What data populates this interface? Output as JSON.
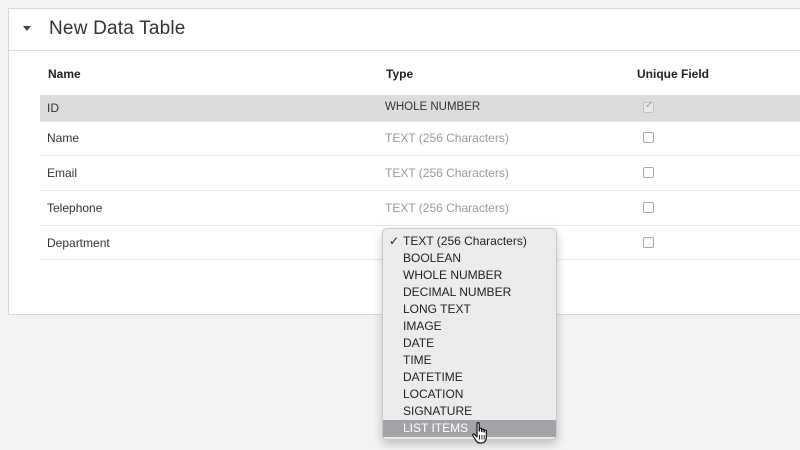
{
  "panel": {
    "title": "New Data Table"
  },
  "columns": {
    "name": "Name",
    "type": "Type",
    "unique": "Unique Field"
  },
  "rows": [
    {
      "name": "ID",
      "type": "WHOLE NUMBER",
      "unique": true,
      "selected": true
    },
    {
      "name": "Name",
      "type": "TEXT (256 Characters)",
      "unique": false
    },
    {
      "name": "Email",
      "type": "TEXT (256 Characters)",
      "unique": false
    },
    {
      "name": "Telephone",
      "type": "TEXT (256 Characters)",
      "unique": false
    },
    {
      "name": "Department",
      "type": "TEXT (256 Characters)",
      "unique": false
    }
  ],
  "type_dropdown": {
    "selected": "TEXT (256 Characters)",
    "hovered": "LIST ITEMS",
    "check_glyph": "✓",
    "options": [
      "TEXT (256 Characters)",
      "BOOLEAN",
      "WHOLE NUMBER",
      "DECIMAL NUMBER",
      "LONG TEXT",
      "IMAGE",
      "DATE",
      "TIME",
      "DATETIME",
      "LOCATION",
      "SIGNATURE",
      "LIST ITEMS"
    ]
  },
  "icons": {
    "collapse": "triangle-down-icon",
    "cursor": "hand-pointer-icon",
    "checkmark": "checkmark-icon"
  }
}
